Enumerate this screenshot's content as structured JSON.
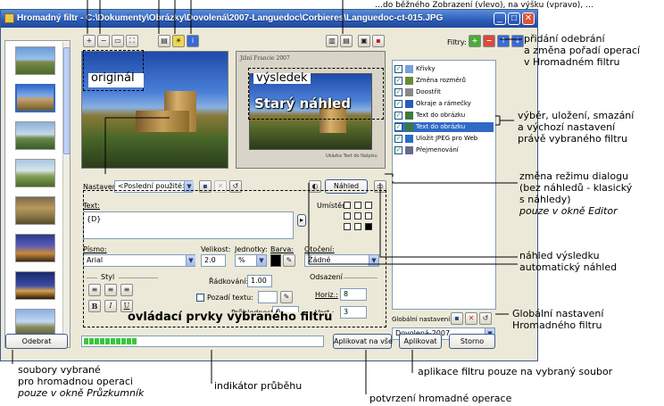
{
  "window": {
    "title": "Hromadný filtr - C:\\Dokumenty\\Obrázky\\Dovolená\\2007-Languedoc\\Corbieres\\Languedoc-ct-015.JPG"
  },
  "top_toolbar": {
    "left_tools": [
      "zoom-in-icon",
      "zoom-out-icon",
      "fit-icon",
      "fullsize-icon",
      "compare-icon",
      "highlight-icon",
      "info-icon"
    ],
    "right_tools": [
      "split-vertical-icon",
      "split-horizontal-icon",
      "single-icon",
      "close-preview-icon"
    ]
  },
  "thumbnails_count": 8,
  "preview": {
    "original_label": "originál",
    "result_label": "výsledek",
    "result_header": "Jižní Francie 2007",
    "overlay_text": "Starý náhled",
    "small_caption": "Ukázka Text do Nalpisu"
  },
  "filters": {
    "label": "Filtry:",
    "items": [
      {
        "name": "Křivky",
        "checked": true,
        "icon": "curves-icon",
        "color": "#7aa0d8"
      },
      {
        "name": "Změna rozměrů",
        "checked": true,
        "icon": "resize-icon",
        "color": "#6a8a3a"
      },
      {
        "name": "Doostřit",
        "checked": true,
        "icon": "sharpen-icon",
        "color": "#888888"
      },
      {
        "name": "Okraje a rámečky",
        "checked": true,
        "icon": "frame-icon",
        "color": "#2a5ab8"
      },
      {
        "name": "Text do obrázku",
        "checked": true,
        "icon": "text-icon",
        "color": "#3a7a3a"
      },
      {
        "name": "Text do obrázku",
        "checked": true,
        "icon": "text-icon",
        "color": "#3a7a3a",
        "selected": true
      },
      {
        "name": "Uložit JPEG pro Web",
        "checked": true,
        "icon": "save-web-icon",
        "color": "#2a6ac8"
      },
      {
        "name": "Přejmenování",
        "checked": true,
        "icon": "rename-icon",
        "color": "#6a6a8a"
      }
    ]
  },
  "settings": {
    "label": "Nastavení:",
    "value": "<Poslední použité>",
    "preview_button": "Náhled"
  },
  "text_panel": {
    "text_label": "Text:",
    "text_value": "{D}",
    "placement_label": "Umístění:",
    "font_label": "Písmo:",
    "font_value": "Arial",
    "size_label": "Velikost:",
    "size_value": "2.0",
    "units_label": "Jednotky:",
    "units_value": "%",
    "color_label": "Barva:",
    "rotation_label": "Otočení:",
    "rotation_value": "Žádné",
    "style_label": "Styl",
    "style_bold": "B",
    "style_italic": "I",
    "style_underline": "U",
    "line_spacing_label": "Řádkování:",
    "line_spacing_value": "1.00",
    "background_label": "Pozadí textu:",
    "transparency_label": "Průhlednost:",
    "transparency_value": "0",
    "offset_label": "Odsazení",
    "horizontal_label": "Horiz.:",
    "horizontal_value": "8",
    "vertical_label": "Vert.:",
    "vertical_value": "3",
    "caption": "ovládací prvky vybraného filtru"
  },
  "global_settings": {
    "label": "Globální nastavení:",
    "value": "Dovolená-2007"
  },
  "bottom": {
    "remove_button": "Odebrat",
    "progress": 0.22,
    "apply_all_button": "Aplikovat na vše",
    "apply_button": "Aplikovat",
    "cancel_button": "Storno"
  },
  "annotations": {
    "top_right_partial": "…do běžného Zobrazení (vlevo), na výšku (vpravo), …",
    "filters_ops": [
      "přidání odebrání",
      "a změna pořadí operací",
      "v Hromadném filtru"
    ],
    "selected_ops": [
      "výběr, uložení, smazání",
      "a výchozí nastavení",
      "právě vybraného filtru"
    ],
    "dialog_mode": [
      "změna režimu dialogu",
      "(bez náhledů - klasický",
      "s náhledy)",
      "pouze v okně Editor"
    ],
    "preview_result": [
      "náhled výsledku",
      "automatický náhled"
    ],
    "global": [
      "Globální nastavení",
      "Hromadného filtru"
    ],
    "files_selected": [
      "soubory vybrané",
      "pro hromadnou operaci",
      "pouze v okně Průzkumník"
    ],
    "progress_indicator": "indikátor průběhu",
    "apply_selected": "aplikace filtru pouze na vybraný soubor",
    "confirm_batch": "potvrzení hromadné operace"
  }
}
